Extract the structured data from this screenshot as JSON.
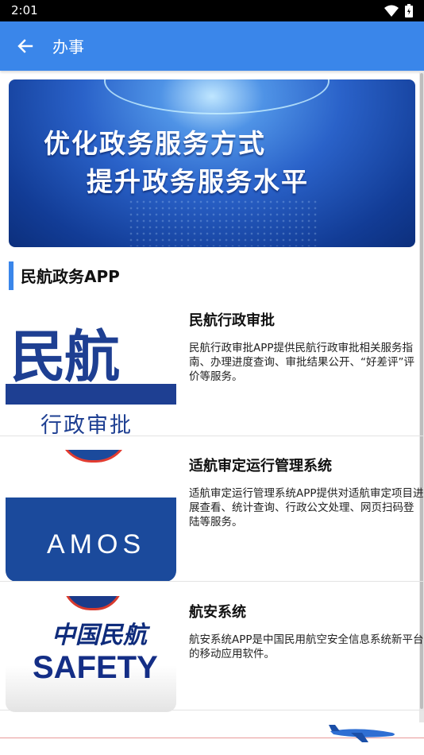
{
  "status_bar": {
    "time": "2:01"
  },
  "app_bar": {
    "title": "办事"
  },
  "banner": {
    "line1": "优化政务服务方式",
    "line2": "提升政务服务水平"
  },
  "section": {
    "title": "民航政务APP"
  },
  "apps": [
    {
      "name": "民航行政审批",
      "description": "民航行政审批APP提供民航行政审批相关服务指南、办理进度查询、审批结果公开、“好差评”评价等服务。",
      "image_text_main": "民航",
      "image_text_sub": "行政审批"
    },
    {
      "name": "适航审定运行管理系统",
      "description": "适航审定运行管理系统APP提供对适航审定项目进展查看、统计查询、行政公文处理、网页扫码登陆等服务。",
      "image_text": "AMOS"
    },
    {
      "name": "航安系统",
      "description": "航安系统APP是中国民用航空安全信息系统新平台的移动应用软件。",
      "image_text_cn": "中国民航",
      "image_text_en": "SAFETY"
    }
  ],
  "colors": {
    "app_bar": "#3a86ea",
    "accent": "#3a86ea",
    "brand_blue": "#1e3f92",
    "brand_red": "#e23c31"
  },
  "icons": {
    "back": "arrow-left-icon",
    "wifi": "wifi-icon",
    "battery": "battery-icon",
    "plane": "airplane-icon"
  }
}
